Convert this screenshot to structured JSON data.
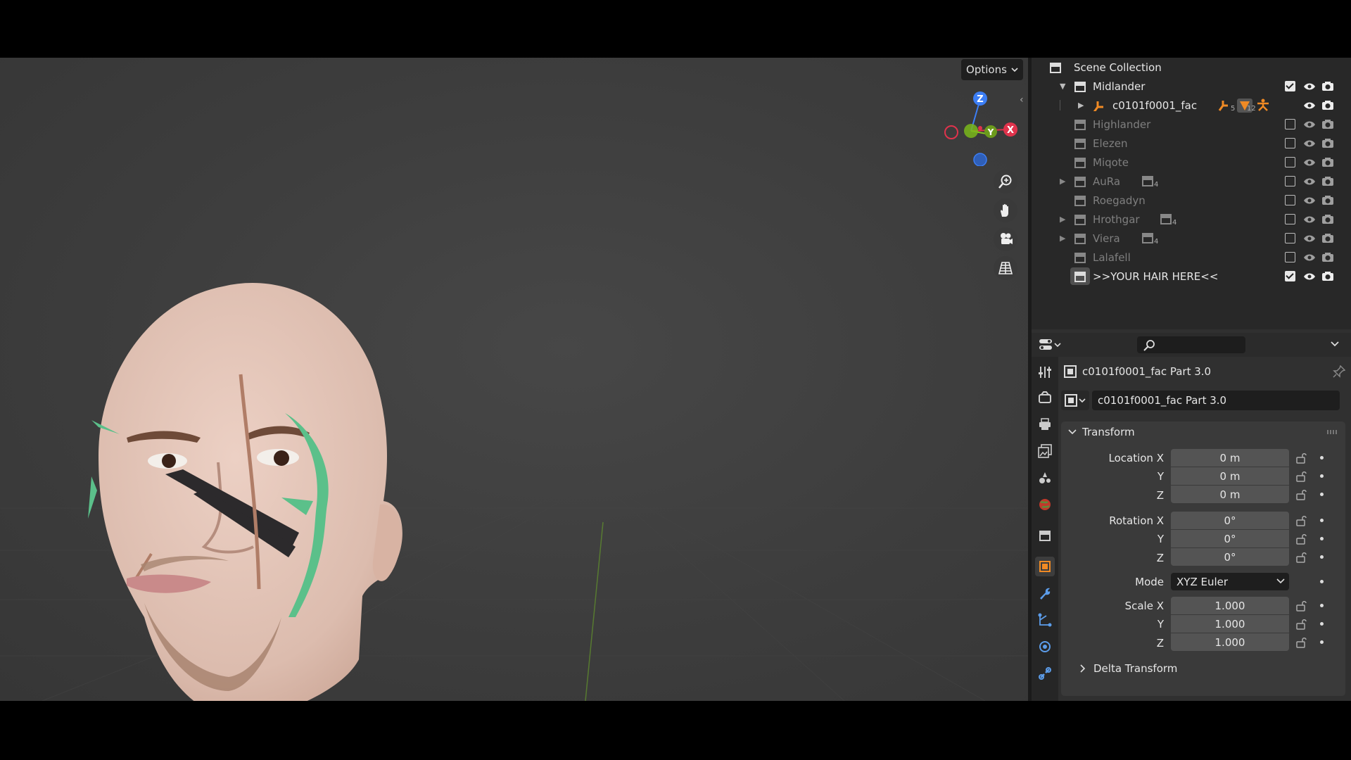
{
  "viewport": {
    "options_label": "Options",
    "gizmo": {
      "z_label": "Z",
      "y_label": "Y",
      "x_label": "X",
      "colors": {
        "x": "#e0334c",
        "y": "#8ac920",
        "z": "#3c7ef5"
      }
    }
  },
  "outliner": {
    "root": "Scene Collection",
    "rows": [
      {
        "name": "Midlander",
        "expanded": true,
        "enabled": true
      },
      {
        "name": "c0101f0001_fac",
        "badge1": "5",
        "badge2": "12"
      },
      {
        "name": "Highlander"
      },
      {
        "name": "Elezen"
      },
      {
        "name": "Miqote"
      },
      {
        "name": "AuRa",
        "badge": "4"
      },
      {
        "name": "Roegadyn"
      },
      {
        "name": "Hrothgar",
        "badge": "4"
      },
      {
        "name": "Viera",
        "badge": "4"
      },
      {
        "name": "Lalafell"
      },
      {
        "name": ">>YOUR HAIR HERE<<",
        "enabled": true
      }
    ]
  },
  "properties": {
    "object_name": "c0101f0001_fac Part 3.0",
    "data_name": "c0101f0001_fac Part 3.0",
    "transform": {
      "title": "Transform",
      "location_label": "Location X",
      "rotation_label": "Rotation X",
      "scale_label": "Scale X",
      "y_label": "Y",
      "z_label": "Z",
      "location": [
        "0 m",
        "0 m",
        "0 m"
      ],
      "rotation": [
        "0°",
        "0°",
        "0°"
      ],
      "mode_label": "Mode",
      "mode_value": "XYZ Euler",
      "scale": [
        "1.000",
        "1.000",
        "1.000"
      ]
    },
    "delta_label": "Delta Transform"
  }
}
